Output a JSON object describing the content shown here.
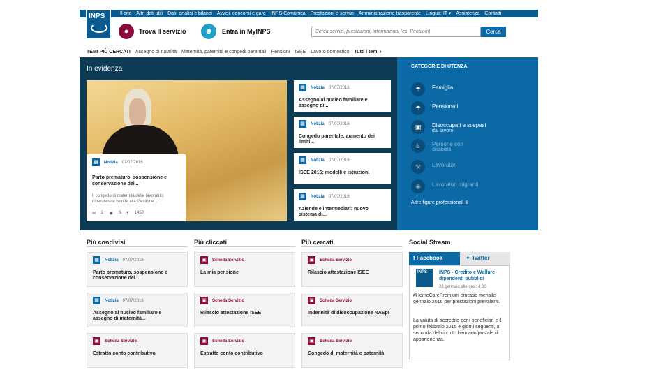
{
  "topnav": [
    "Il sito",
    "Altri dati utili",
    "Dati, analisi e bilanci",
    "Avvisi, concorsi e gare",
    "INPS Comunica",
    "Prestazioni e servizi",
    "Amministrazione trasparente",
    "Lingua: IT ▾",
    "Assistenza",
    "Contatti"
  ],
  "logo": {
    "text": "INPS"
  },
  "header": {
    "trova_label": "Trova il servizio",
    "myinps_label": "Entra in MyINPS",
    "search_placeholder": "Cerca servizi, prestazioni, informazioni (es. Pensioni)",
    "search_button": "Cerca"
  },
  "tags": {
    "lead": "TEMI PIÙ CERCATI",
    "items": [
      "Assegno di natalità",
      "Maternità, paternità e congedi parentali",
      "Pensioni",
      "ISEE",
      "Lavoro domestico"
    ],
    "all": "Tutti i temi ›"
  },
  "evidenza": {
    "title": "In evidenza",
    "hero": {
      "type": "Notizia",
      "date": "07/07/2016",
      "headline": "Parto prematuro, sospensione e conservazione del...",
      "text": "Il congedo di maternità delle lavoratrici dipendenti e iscritte alla Gestione...",
      "stat_comments": "2",
      "stat_views": "8",
      "stat_likes": "1450"
    },
    "news": [
      {
        "type": "Notizia",
        "date": "07/07/2016",
        "headline": "Assegno al nucleo familiare e assegno di..."
      },
      {
        "type": "Notizia",
        "date": "07/07/2016",
        "headline": "Congedo parentale: aumento dei limiti..."
      },
      {
        "type": "Notizia",
        "date": "07/07/2016",
        "headline": "ISEE 2016: modelli e istruzioni"
      },
      {
        "type": "Notizia",
        "date": "07/07/2016",
        "headline": "Aziende e intermediari: nuovo sistema di..."
      }
    ]
  },
  "categorie": {
    "title": "CATEGORIE DI UTENZA",
    "items": [
      {
        "label": "Famiglia",
        "sub": ""
      },
      {
        "label": "Pensionati",
        "sub": ""
      },
      {
        "label": "Disoccupati e sospesi",
        "sub": "dal lavoro"
      },
      {
        "label": "Persone con",
        "sub": "disabilità"
      },
      {
        "label": "Lavoratori",
        "sub": ""
      },
      {
        "label": "Lavoratori migranti",
        "sub": ""
      }
    ],
    "more": "Altre figure professionali ⊕"
  },
  "columns": [
    {
      "title": "Più condivisi",
      "cards": [
        {
          "type": "Notizia",
          "date": "07/07/2016",
          "headline": "Parto prematuro, sospensione e conservazione del..."
        },
        {
          "type": "Notizia",
          "date": "07/07/2016",
          "headline": "Assegno al nucleo familiare e assegno di maternità..."
        },
        {
          "type": "Scheda Servizio",
          "date": "",
          "headline": "Estratto conto contributivo"
        }
      ]
    },
    {
      "title": "Più cliccati",
      "cards": [
        {
          "type": "Scheda Servizio",
          "date": "",
          "headline": "La mia pensione"
        },
        {
          "type": "Scheda Servizio",
          "date": "",
          "headline": "Rilascio attestazione ISEE"
        },
        {
          "type": "Scheda Servizio",
          "date": "",
          "headline": "Estratto conto contributivo"
        }
      ]
    },
    {
      "title": "Più cercati",
      "cards": [
        {
          "type": "Scheda Servizio",
          "date": "",
          "headline": "Rilascio attestazione ISEE"
        },
        {
          "type": "Scheda Servizio",
          "date": "",
          "headline": "Indennità di disoccupazione NASpI"
        },
        {
          "type": "Scheda Servizio",
          "date": "",
          "headline": "Congedo di maternità e paternità"
        }
      ]
    }
  ],
  "social": {
    "title": "Social Stream",
    "tab_facebook": "Facebook",
    "tab_twitter": "Twitter",
    "post": {
      "author": "INPS - Credito e Welfare dipendenti pubblici",
      "date": "28 gennaio alle ore 14:30",
      "text1": "#HomeCarePremium emesso mensile gennaio 2016 per prestazioni prevalenti.",
      "text2": "La valuta di accredito per i beneficiari e il primo febbraio 2016 e giorni seguenti, a seconda del circuito bancario/postale di appartenenza."
    }
  },
  "colors": {
    "primary": "#0b5b8f",
    "accent": "#0b6aa6",
    "dark": "#0d3b56",
    "scheda": "#8a0b3d"
  }
}
